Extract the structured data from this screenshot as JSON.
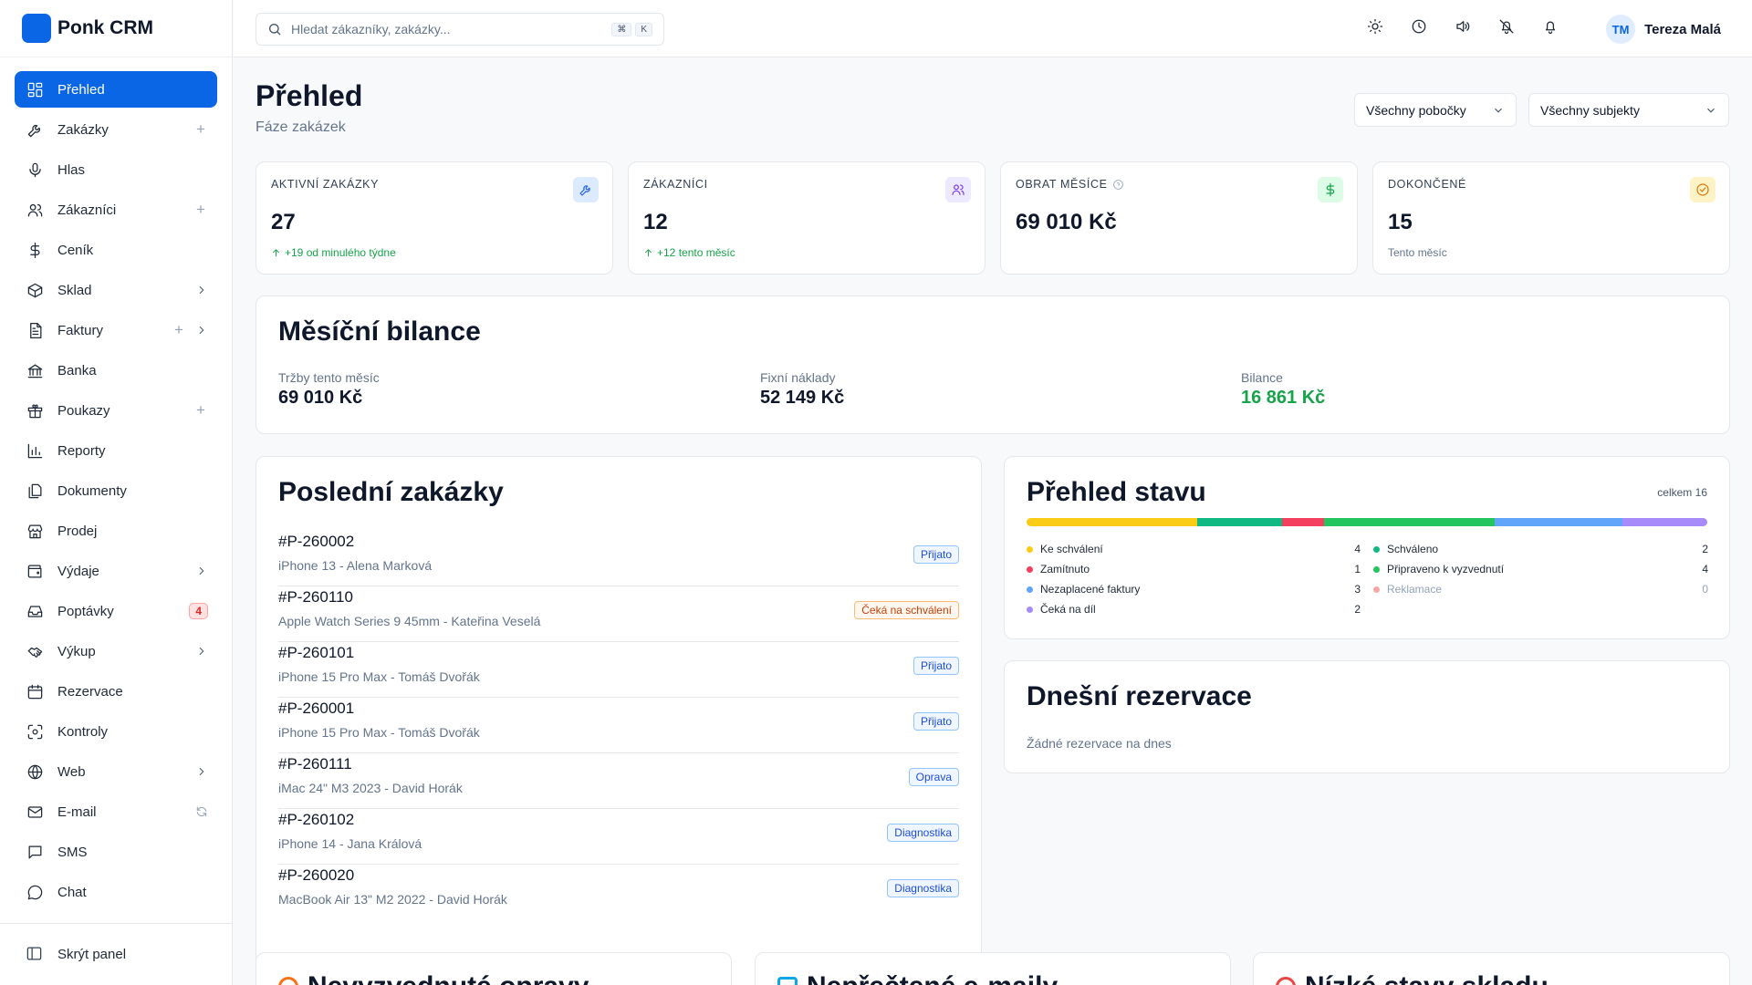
{
  "app": {
    "name": "Ponk CRM"
  },
  "sidebar": {
    "items": [
      {
        "label": "Přehled",
        "icon": "dashboard-icon",
        "active": true
      },
      {
        "label": "Zakázky",
        "icon": "wrench-icon",
        "plus": "+"
      },
      {
        "label": "Hlas",
        "icon": "microphone-icon"
      },
      {
        "label": "Zákazníci",
        "icon": "users-icon",
        "plus": "+"
      },
      {
        "label": "Ceník",
        "icon": "dollar-icon"
      },
      {
        "label": "Sklad",
        "icon": "box-icon",
        "chevron": true
      },
      {
        "label": "Faktury",
        "icon": "invoice-icon",
        "plus": "+",
        "chevron": true
      },
      {
        "label": "Banka",
        "icon": "bank-icon"
      },
      {
        "label": "Poukazy",
        "icon": "gift-icon",
        "plus": "+"
      },
      {
        "label": "Reporty",
        "icon": "bar-chart-icon"
      },
      {
        "label": "Dokumenty",
        "icon": "documents-icon"
      },
      {
        "label": "Prodej",
        "icon": "store-icon"
      },
      {
        "label": "Výdaje",
        "icon": "wallet-icon",
        "chevron": true
      },
      {
        "label": "Poptávky",
        "icon": "inbox-icon",
        "badge": "4"
      },
      {
        "label": "Výkup",
        "icon": "handshake-icon",
        "chevron": true
      },
      {
        "label": "Rezervace",
        "icon": "calendar-icon"
      },
      {
        "label": "Kontroly",
        "icon": "scan-icon"
      },
      {
        "label": "Web",
        "icon": "globe-icon",
        "chevron": true
      },
      {
        "label": "E-mail",
        "icon": "mail-icon",
        "refresh": true
      },
      {
        "label": "SMS",
        "icon": "message-icon"
      },
      {
        "label": "Chat",
        "icon": "chat-icon"
      }
    ],
    "hide_panel": "Skrýt panel"
  },
  "topbar": {
    "search_placeholder": "Hledat zákazníky, zakázky...",
    "kbd": [
      "⌘",
      "K"
    ],
    "user": {
      "initials": "TM",
      "name": "Tereza Malá"
    }
  },
  "page": {
    "title": "Přehled",
    "subtitle": "Fáze zakázek",
    "filter_branch": "Všechny pobočky",
    "filter_subject": "Všechny subjekty"
  },
  "stats": [
    {
      "title": "AKTIVNÍ ZAKÁZKY",
      "value": "27",
      "note": "+19 od minulého týdne",
      "icon": "wrench-icon",
      "color": "#2563eb",
      "bg": "#dbeafe",
      "trend": true
    },
    {
      "title": "ZÁKAZNÍCI",
      "value": "12",
      "note": "+12 tento měsíc",
      "icon": "users-icon",
      "color": "#7c3aed",
      "bg": "#ede9fe",
      "trend": true
    },
    {
      "title": "OBRAT MĚSÍCE",
      "value": "69 010 Kč",
      "note": "",
      "icon": "dollar-icon",
      "color": "#16a34a",
      "bg": "#dcfce7",
      "info": true
    },
    {
      "title": "DOKONČENÉ",
      "value": "15",
      "note": "Tento měsíc",
      "icon": "check-circle-icon",
      "color": "#d97706",
      "bg": "#fef3c7",
      "trend": false
    }
  ],
  "balance": {
    "title": "Měsíční bilance",
    "revenue_label": "Tržby tento měsíc",
    "revenue_value": "69 010 Kč",
    "costs_label": "Fixní náklady",
    "costs_value": "52 149 Kč",
    "balance_label": "Bilance",
    "balance_value": "16 861 Kč",
    "balance_color": "#16a34a"
  },
  "orders": {
    "title": "Poslední zakázky",
    "rows": [
      {
        "id": "#P-260002",
        "desc": "iPhone 13 - Alena Marková",
        "status": "Přijato",
        "tone": "blue"
      },
      {
        "id": "#P-260110",
        "desc": "Apple Watch Series 9 45mm - Kateřina Veselá",
        "status": "Čeká na schválení",
        "tone": "orange"
      },
      {
        "id": "#P-260101",
        "desc": "iPhone 15 Pro Max - Tomáš Dvořák",
        "status": "Přijato",
        "tone": "blue"
      },
      {
        "id": "#P-260001",
        "desc": "iPhone 15 Pro Max - Tomáš Dvořák",
        "status": "Přijato",
        "tone": "blue"
      },
      {
        "id": "#P-260111",
        "desc": "iMac 24\" M3 2023 - David Horák",
        "status": "Oprava",
        "tone": "blue"
      },
      {
        "id": "#P-260102",
        "desc": "iPhone 14 - Jana Králová",
        "status": "Diagnostika",
        "tone": "blue"
      },
      {
        "id": "#P-260020",
        "desc": "MacBook Air 13\" M2 2022 - David Horák",
        "status": "Diagnostika",
        "tone": "blue"
      }
    ]
  },
  "status_overview": {
    "title": "Přehled stavu",
    "total": "celkem 16",
    "items": [
      {
        "label": "Ke schválení",
        "count": 4,
        "color": "#facc15"
      },
      {
        "label": "Schváleno",
        "count": 2,
        "color": "#10b981"
      },
      {
        "label": "Zamítnuto",
        "count": 1,
        "color": "#f43f5e"
      },
      {
        "label": "Připraveno k vyzvednutí",
        "count": 4,
        "color": "#22c55e"
      },
      {
        "label": "Nezaplacené faktury",
        "count": 3,
        "color": "#60a5fa"
      },
      {
        "label": "Reklamace",
        "count": 0,
        "color": "#fca5a5"
      },
      {
        "label": "Čeká na díl",
        "count": 2,
        "color": "#a78bfa"
      }
    ]
  },
  "reservations": {
    "title": "Dnešní rezervace",
    "empty": "Žádné rezervace na dnes"
  },
  "bottom_cards": [
    {
      "title": "Nevyzvednuté opravy",
      "color": "#f97316"
    },
    {
      "title": "Nepřečtené e-maily",
      "color": "#0ea5e9"
    },
    {
      "title": "Nízké stavy skladu",
      "color": "#ef4444"
    }
  ]
}
